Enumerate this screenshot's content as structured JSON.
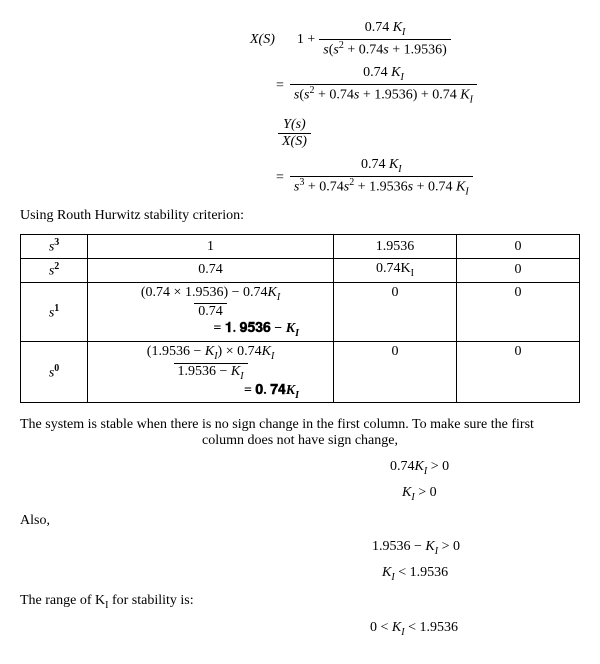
{
  "eq1": {
    "lhs_top": "X(S)",
    "rhs_prefix": "1 +",
    "num": "0.74 K_I",
    "den": "s(s^2 + 0.74s + 1.9536)"
  },
  "eq2": {
    "num": "0.74 K_I",
    "den": "s(s^2 + 0.74s + 1.9536) + 0.74 K_I"
  },
  "eq3": {
    "top": "Y(s)",
    "bot": "X(S)"
  },
  "eq4": {
    "num": "0.74 K_I",
    "den": "s^3 + 0.74s^2 + 1.9536s + 0.74 K_I"
  },
  "text": {
    "routh_intro": "Using Routh Hurwitz stability criterion:",
    "stable_intro1": "The system is stable when there is no sign change in the first column. To make sure the first",
    "stable_intro2": "column does not have sign change,",
    "also": "Also,",
    "range": "The range of K_I for stability is:"
  },
  "table": {
    "rows": [
      {
        "power": "s^3",
        "col2": "1",
        "col3": "1.9536",
        "col4": "0"
      },
      {
        "power": "s^2",
        "col2": "0.74",
        "col3": "0.74K_I",
        "col4": "0"
      },
      {
        "power": "s^1",
        "col2_num": "(0.74 × 1.9536) − 0.74K_I",
        "col2_den": "0.74",
        "col2_result": "= 1.9536 − K_I",
        "col3": "0",
        "col4": "0"
      },
      {
        "power": "s^0",
        "col2_num": "(1.9536 − K_I) × 0.74K_I",
        "col2_den": "1.9536 − K_I",
        "col2_result": "= 0.74K_I",
        "col3": "0",
        "col4": "0"
      }
    ]
  },
  "conditions": {
    "c1": "0.74K_I > 0",
    "c2": "K_I > 0",
    "c3": "1.9536 − K_I > 0",
    "c4": "K_I < 1.9536",
    "final": "0 < K_I < 1.9536"
  }
}
